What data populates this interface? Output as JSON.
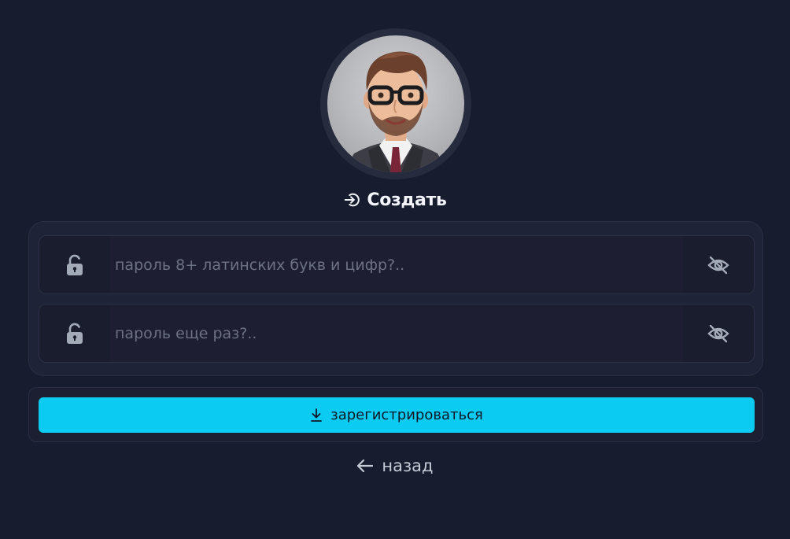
{
  "header": {
    "title": "Создать",
    "title_icon": "login-icon",
    "avatar": "user-avatar"
  },
  "form": {
    "password": {
      "placeholder": "пароль 8+ латинских букв и цифр?..",
      "value": "",
      "lock_icon": "unlock-icon",
      "toggle_icon": "eye-off-icon"
    },
    "password_repeat": {
      "placeholder": "пароль еще раз?..",
      "value": "",
      "lock_icon": "unlock-icon",
      "toggle_icon": "eye-off-icon"
    }
  },
  "actions": {
    "register_label": "зарегистрироваться",
    "register_icon": "download-icon",
    "back_label": "назад",
    "back_icon": "arrow-left-icon"
  },
  "colors": {
    "background": "#171c2e",
    "accent": "#0ccbf2",
    "card": "#1f2337"
  }
}
